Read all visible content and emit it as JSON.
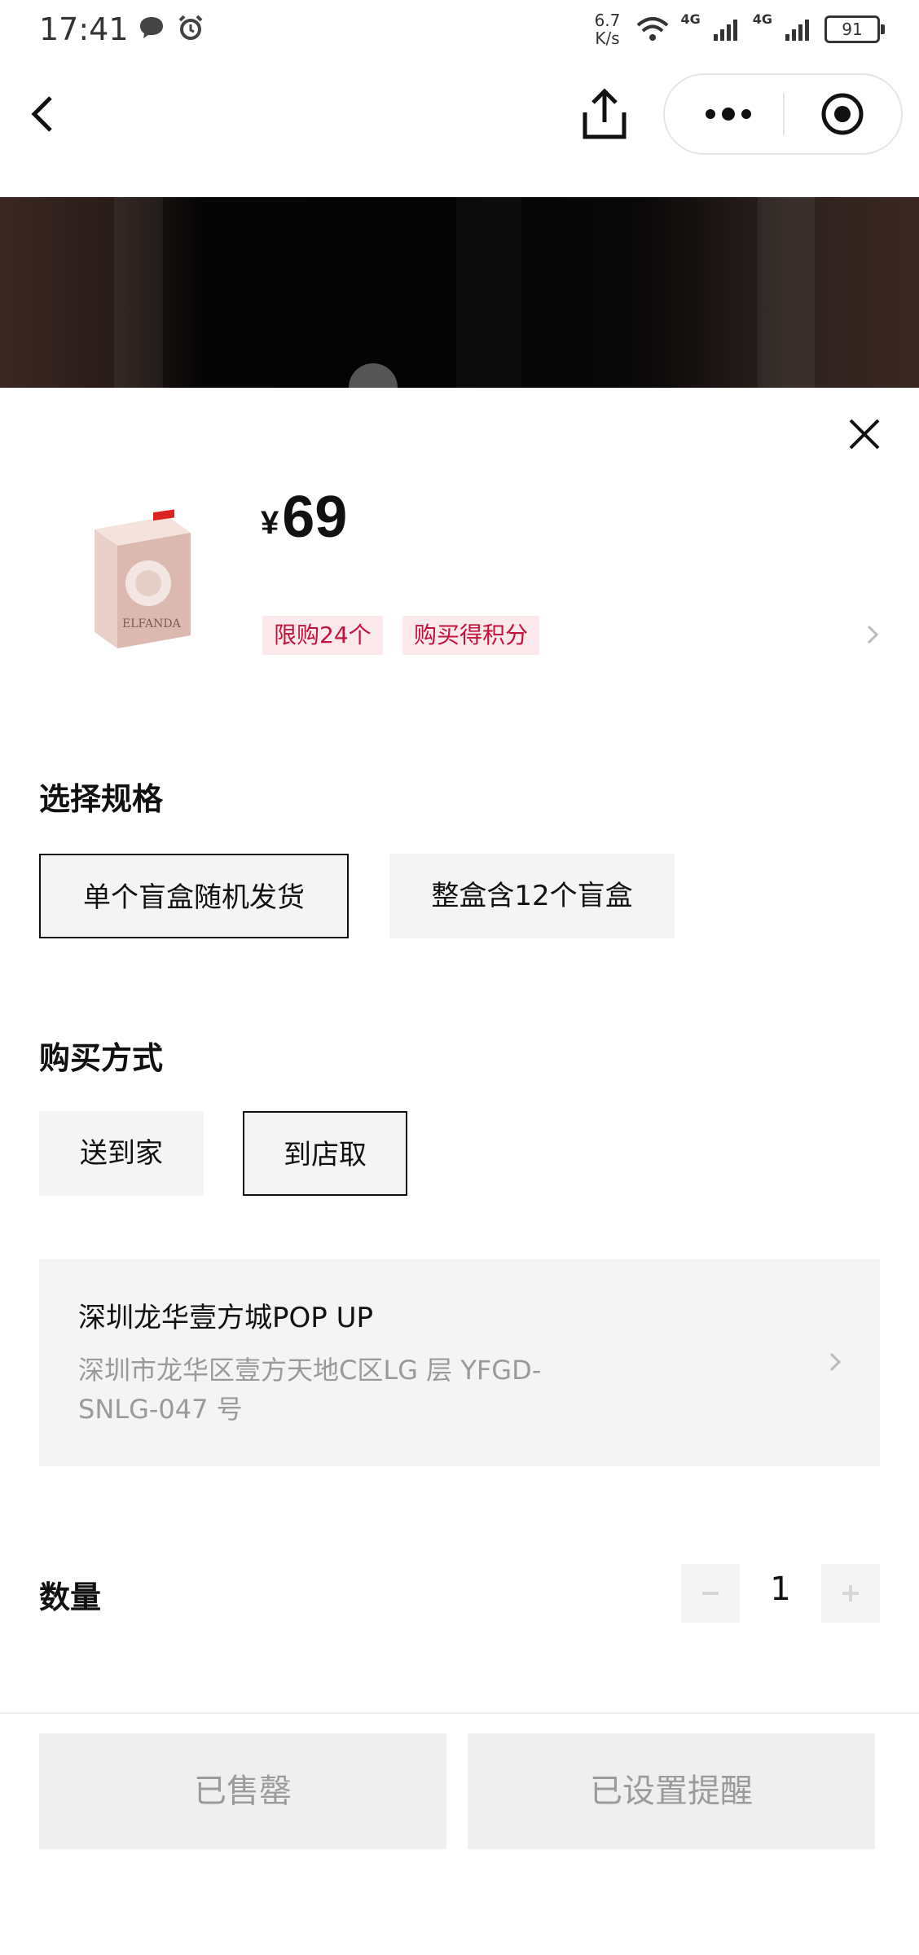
{
  "status_bar": {
    "time": "17:41",
    "net_speed_value": "6.7",
    "net_speed_unit": "K/s",
    "sig1": "4G",
    "sig2": "4G",
    "battery": "91"
  },
  "product": {
    "currency": "¥",
    "price": "69",
    "tags": [
      "限购24个",
      "购买得积分"
    ],
    "image_text": "ELFANDA"
  },
  "spec_section": {
    "title": "选择规格",
    "options": [
      {
        "label": "单个盲盒随机发货",
        "selected": true
      },
      {
        "label": "整盒含12个盲盒",
        "selected": false
      }
    ]
  },
  "method_section": {
    "title": "购买方式",
    "options": [
      {
        "label": "送到家",
        "selected": false
      },
      {
        "label": "到店取",
        "selected": true
      }
    ]
  },
  "store": {
    "name": "深圳龙华壹方城POP UP",
    "address_line1": "深圳市龙华区壹方天地C区LG 层 YFGD-",
    "address_line2": "SNLG-047 号"
  },
  "quantity": {
    "title": "数量",
    "minus": "−",
    "value": "1",
    "plus": "+"
  },
  "footer": {
    "sold_out": "已售罄",
    "reminder_set": "已设置提醒"
  },
  "colors": {
    "tag_bg": "#fbe9ec",
    "tag_text": "#c4123a",
    "option_bg": "#f4f4f4",
    "disabled_text": "#9b9b9b"
  }
}
